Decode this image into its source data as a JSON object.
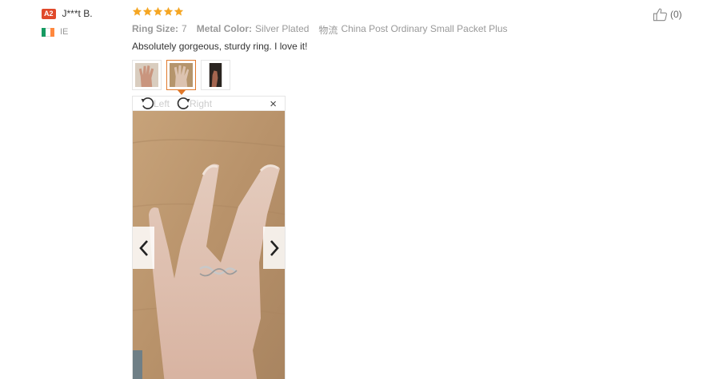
{
  "reviewer": {
    "level_badge": "A2",
    "name": "J***t B.",
    "country": "IE",
    "flag_colors": [
      "#169b62",
      "#ffffff",
      "#ff883e"
    ]
  },
  "review": {
    "rating": 5,
    "star_color": "#f5a623",
    "attributes": [
      {
        "key": "Ring Size:",
        "value": "7"
      },
      {
        "key": "Metal Color:",
        "value": "Silver Plated"
      }
    ],
    "logistics": {
      "key": "物流",
      "value": "China Post Ordinary Small Packet Plus"
    },
    "text": "Absolutely gorgeous, sturdy ring. I love it!"
  },
  "helpful": {
    "count": "(0)"
  },
  "thumbnails": [
    {
      "name": "photo-1",
      "active": false
    },
    {
      "name": "photo-2",
      "active": true
    },
    {
      "name": "photo-3",
      "active": false
    }
  ],
  "viewer": {
    "rotate_left": "Left",
    "rotate_right": "Right",
    "close": "×"
  }
}
